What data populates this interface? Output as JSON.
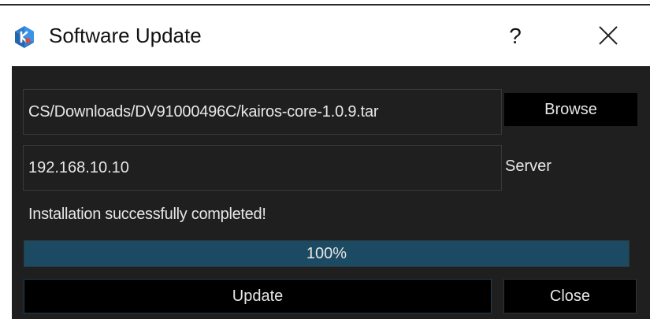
{
  "window": {
    "title": "Software Update",
    "help_label": "?",
    "close_icon": "close-icon",
    "app_icon": "kairos-logo-icon",
    "accent_color": "#1c4a63"
  },
  "form": {
    "file_path": "CS/Downloads/DV91000496C/kairos-core-1.0.9.tar",
    "browse_label": "Browse",
    "server_address": "192.168.10.10",
    "server_label": "Server"
  },
  "status": {
    "message": "Installation successfully completed!"
  },
  "progress": {
    "value": 100,
    "label": "100%"
  },
  "actions": {
    "update_label": "Update",
    "close_label": "Close"
  }
}
